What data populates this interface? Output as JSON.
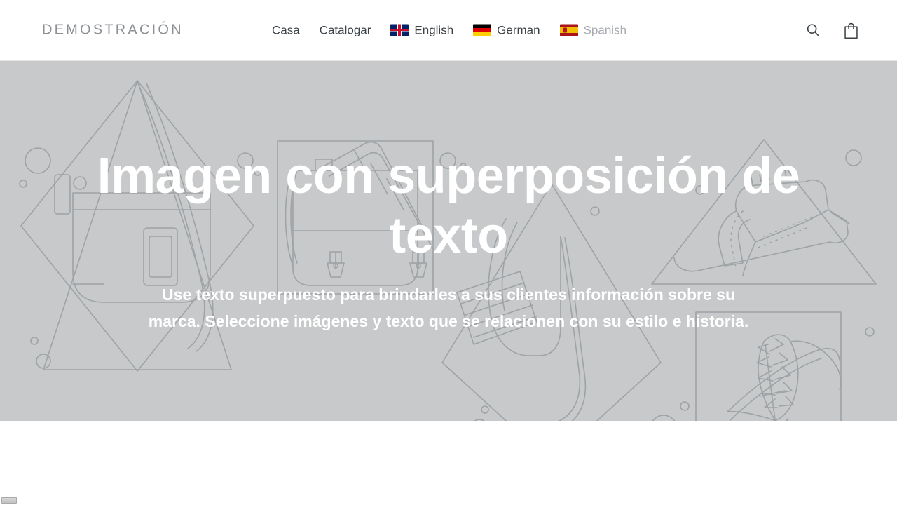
{
  "header": {
    "brand": "DEMOSTRACIÓN",
    "nav": [
      {
        "label": "Casa",
        "icon": null,
        "muted": false
      },
      {
        "label": "Catalogar",
        "icon": null,
        "muted": false
      },
      {
        "label": "English",
        "icon": "flag-uk-icon",
        "muted": false
      },
      {
        "label": "German",
        "icon": "flag-germany-icon",
        "muted": false
      },
      {
        "label": "Spanish",
        "icon": "flag-spain-icon",
        "muted": true
      }
    ],
    "actions": [
      {
        "name": "search-icon",
        "label": "Buscar"
      },
      {
        "name": "shopping-bag-icon",
        "label": "Carrito"
      }
    ],
    "colors": {
      "brand_text": "#8c8f94",
      "nav_text": "#3d4246",
      "nav_text_muted": "#a7abaf",
      "background": "#ffffff",
      "border": "#e5e5e5"
    }
  },
  "hero": {
    "title": "Imagen con superposición de texto",
    "subtitle": "Use texto superpuesto para brindarles a sus clientes información sobre su marca. Seleccione imágenes y texto que se relacionen con su estilo e historia.",
    "background_alt": "Ilustración de marcador de posición: bolsos, zapatos, gafas y sombrero",
    "colors": {
      "background": "#c7c9ca",
      "line_art": "#9ea3a6",
      "text": "#ffffff"
    }
  },
  "scrollbar": {
    "orientation": "horizontal",
    "thumb_position_percent": 0
  }
}
